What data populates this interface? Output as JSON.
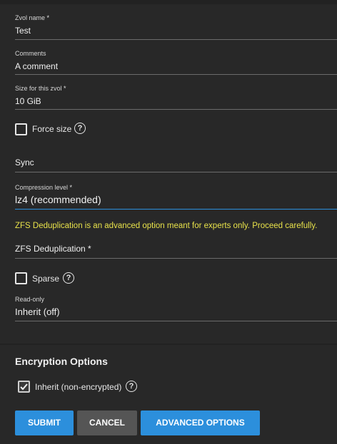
{
  "form": {
    "zvol_name": {
      "label": "Zvol name",
      "required_mark": "*",
      "value": "Test"
    },
    "comments": {
      "label": "Comments",
      "value": "A comment"
    },
    "size": {
      "label": "Size for this zvol",
      "required_mark": "*",
      "value": "10 GiB"
    },
    "force_size": {
      "label": "Force size",
      "checked": false
    },
    "sync": {
      "value": "Sync"
    },
    "compression": {
      "label": "Compression level",
      "required_mark": "*",
      "value": "lz4 (recommended)"
    },
    "dedup_warning": "ZFS Deduplication is an advanced option meant for experts only. Proceed carefully.",
    "dedup": {
      "label": "ZFS Deduplication *"
    },
    "sparse": {
      "label": "Sparse",
      "checked": false
    },
    "readonly": {
      "label": "Read-only",
      "value": "Inherit (off)"
    }
  },
  "encryption": {
    "title": "Encryption Options",
    "inherit": {
      "label": "Inherit (non-encrypted)",
      "checked": true
    }
  },
  "buttons": {
    "submit": "SUBMIT",
    "cancel": "CANCEL",
    "advanced": "ADVANCED OPTIONS"
  },
  "icons": {
    "help": "help-circle-icon",
    "check": "checkmark-icon"
  },
  "colors": {
    "accent": "#2c8fdc",
    "warning": "#e8e24a",
    "required": "#e0e0e0",
    "focus_line": "#2c8fdc"
  }
}
